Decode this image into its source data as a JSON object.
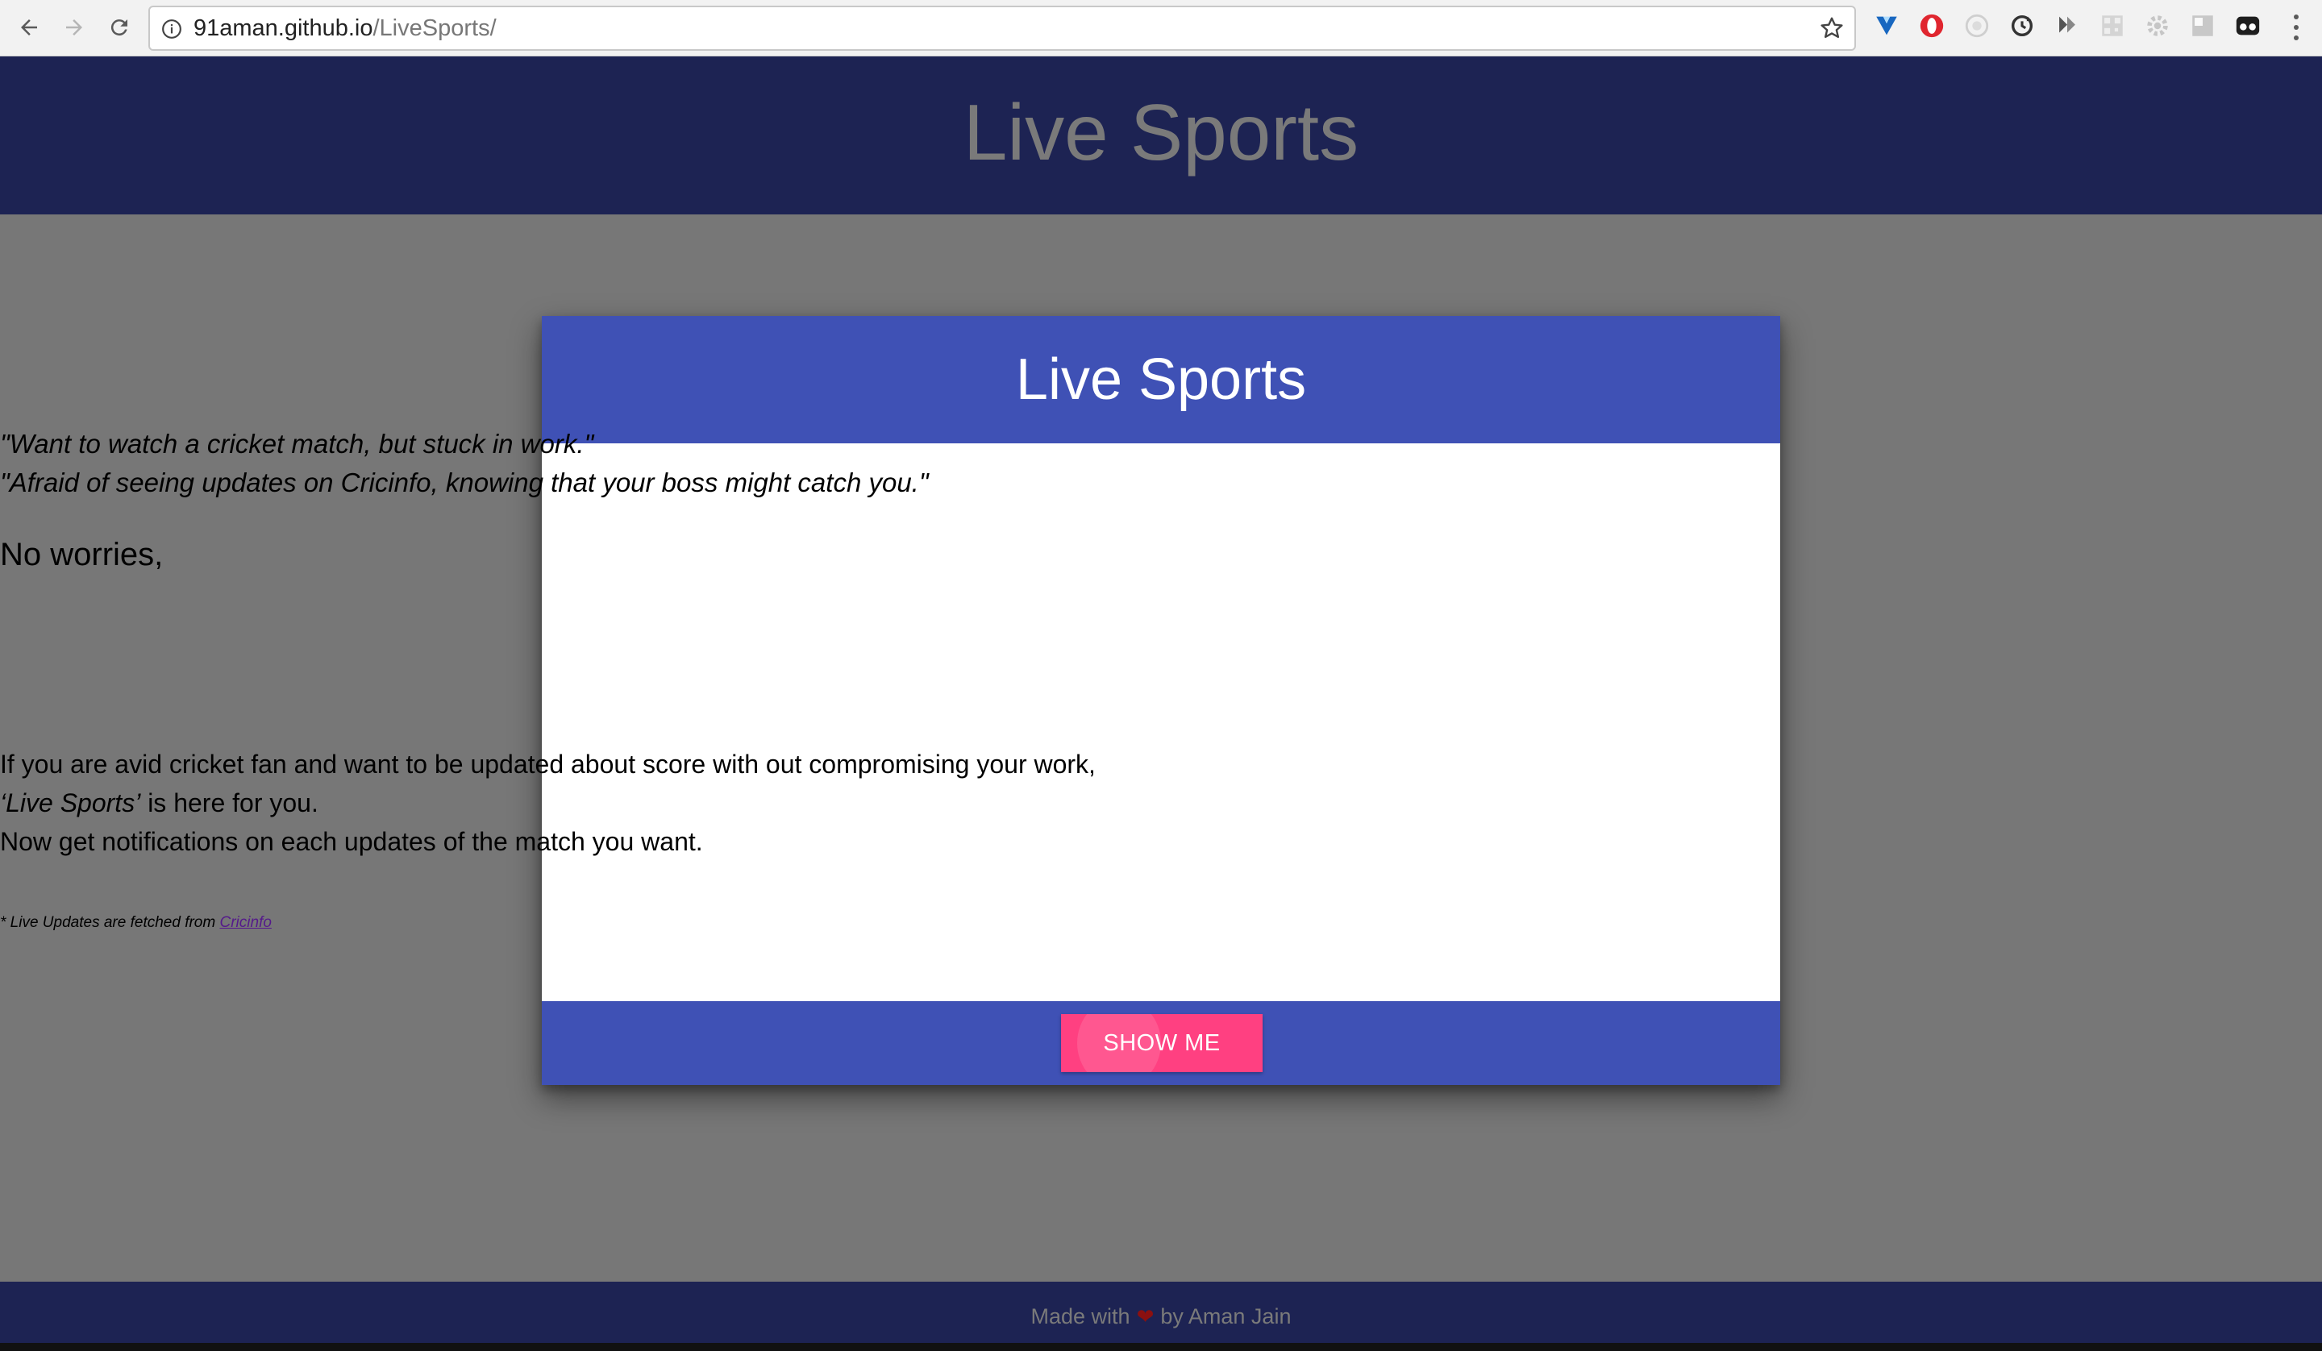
{
  "browser": {
    "url_host": "91aman.github.io",
    "url_path": "/LiveSports/",
    "extensions": [
      "vuetify-icon",
      "opera-icon",
      "recorder-icon",
      "sync-icon",
      "bookmark-icon",
      "qr-icon",
      "gear-icon",
      "panel-icon",
      "mask-icon"
    ]
  },
  "header": {
    "title": "Live Sports"
  },
  "modal": {
    "title": "Live Sports",
    "quote1": "\"Want to watch a cricket match, but stuck in work.\"",
    "quote2": "\"Afraid of seeing updates on Cricinfo, knowing that your boss might catch you.\"",
    "no_worries": "No worries,",
    "para1": "If you are avid cricket fan and want to be updated about score with out compromising your work,",
    "para2_em": "‘Live Sports’",
    "para2_rest": " is here for you.",
    "para3": "Now get notifications on each updates of the match you want.",
    "note_text": "* Live Updates are fetched from ",
    "note_link": "Cricinfo",
    "button_label": "SHOW ME"
  },
  "footer": {
    "made_with": "Made with",
    "by": "by Aman Jain"
  },
  "colors": {
    "header_bg": "#1d2353",
    "modal_accent": "#3f51b5",
    "button": "#ff4081"
  }
}
